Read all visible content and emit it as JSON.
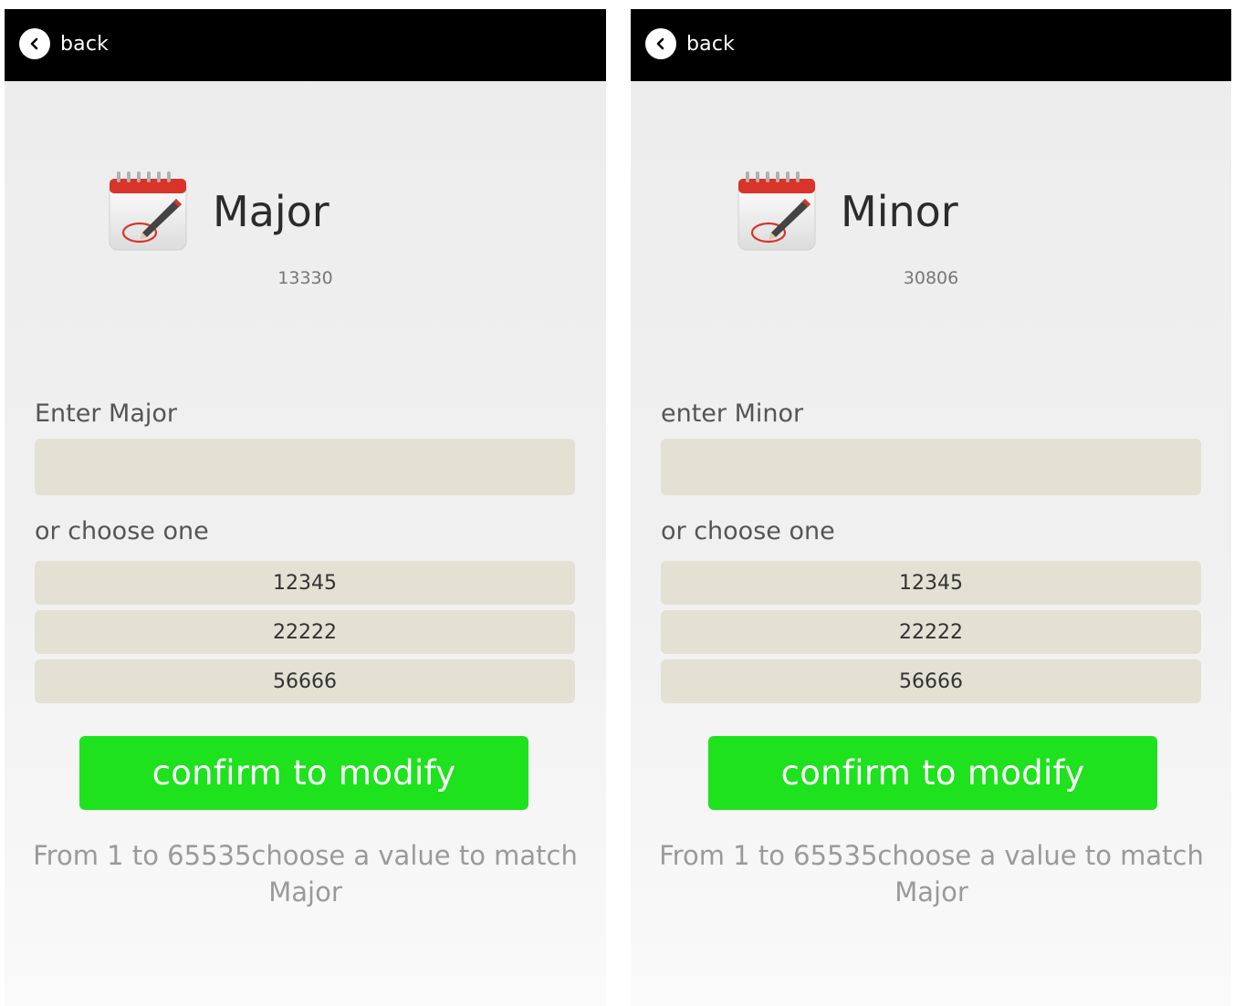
{
  "screens": [
    {
      "back_label": "back",
      "title": "Major",
      "current_value": "13330",
      "enter_label": "Enter Major",
      "input_value": "",
      "choose_label": "or choose one",
      "options": [
        "12345",
        "22222",
        "56666"
      ],
      "confirm_label": "confirm to modify",
      "hint": "From 1 to 65535choose a value to match Major"
    },
    {
      "back_label": "back",
      "title": "Minor",
      "current_value": "30806",
      "enter_label": "enter Minor",
      "input_value": "",
      "choose_label": "or choose one",
      "options": [
        "12345",
        "22222",
        "56666"
      ],
      "confirm_label": "confirm to modify",
      "hint": "From 1 to 65535choose a value to match Major"
    }
  ],
  "icons": {
    "back": "chevron-left-icon",
    "header": "notepad-pen-icon"
  },
  "colors": {
    "topbar": "#000000",
    "field_background": "#e2e1d3",
    "confirm_button": "#1de21d",
    "hint_text": "#9a9a9a"
  }
}
